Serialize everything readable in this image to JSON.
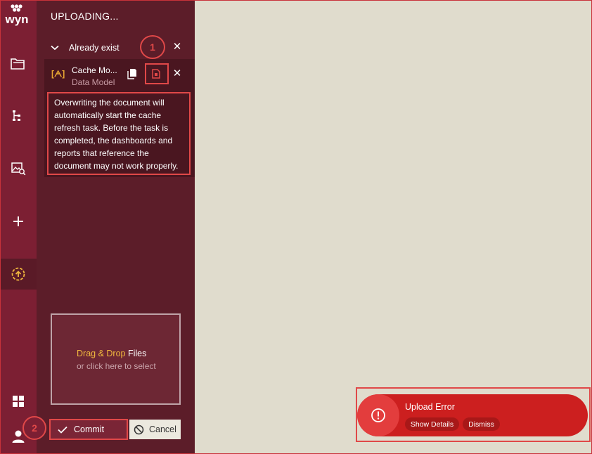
{
  "panel": {
    "title": "UPLOADING...",
    "group_label": "Already exist",
    "item": {
      "name": "Cache Mo...",
      "type": "Data Model",
      "icon_text": "[ᗅ]",
      "warning": "Overwriting the document will automatically start the cache refresh task. Before the task is completed, the dashboards and reports that reference the document may not work properly."
    },
    "dropzone": {
      "accent": "Drag & Drop",
      "rest": " Files",
      "sub": "or click here to select"
    },
    "commit_label": "Commit",
    "cancel_label": "Cancel"
  },
  "annotations": {
    "one": "1",
    "two": "2"
  },
  "toast": {
    "title": "Upload Error",
    "show_details": "Show Details",
    "dismiss": "Dismiss"
  },
  "logo_text": "wyn",
  "icons": [
    "folder-icon",
    "tree-icon",
    "image-search-icon",
    "plus-icon",
    "upload-icon",
    "grid-icon",
    "user-icon"
  ],
  "colors": {
    "rail": "#7c1f33",
    "panel": "#5c1d29",
    "accent": "#f0b83e",
    "annotation": "#e04848",
    "toast": "#cc1f1f",
    "canvas": "#e0dccd"
  }
}
